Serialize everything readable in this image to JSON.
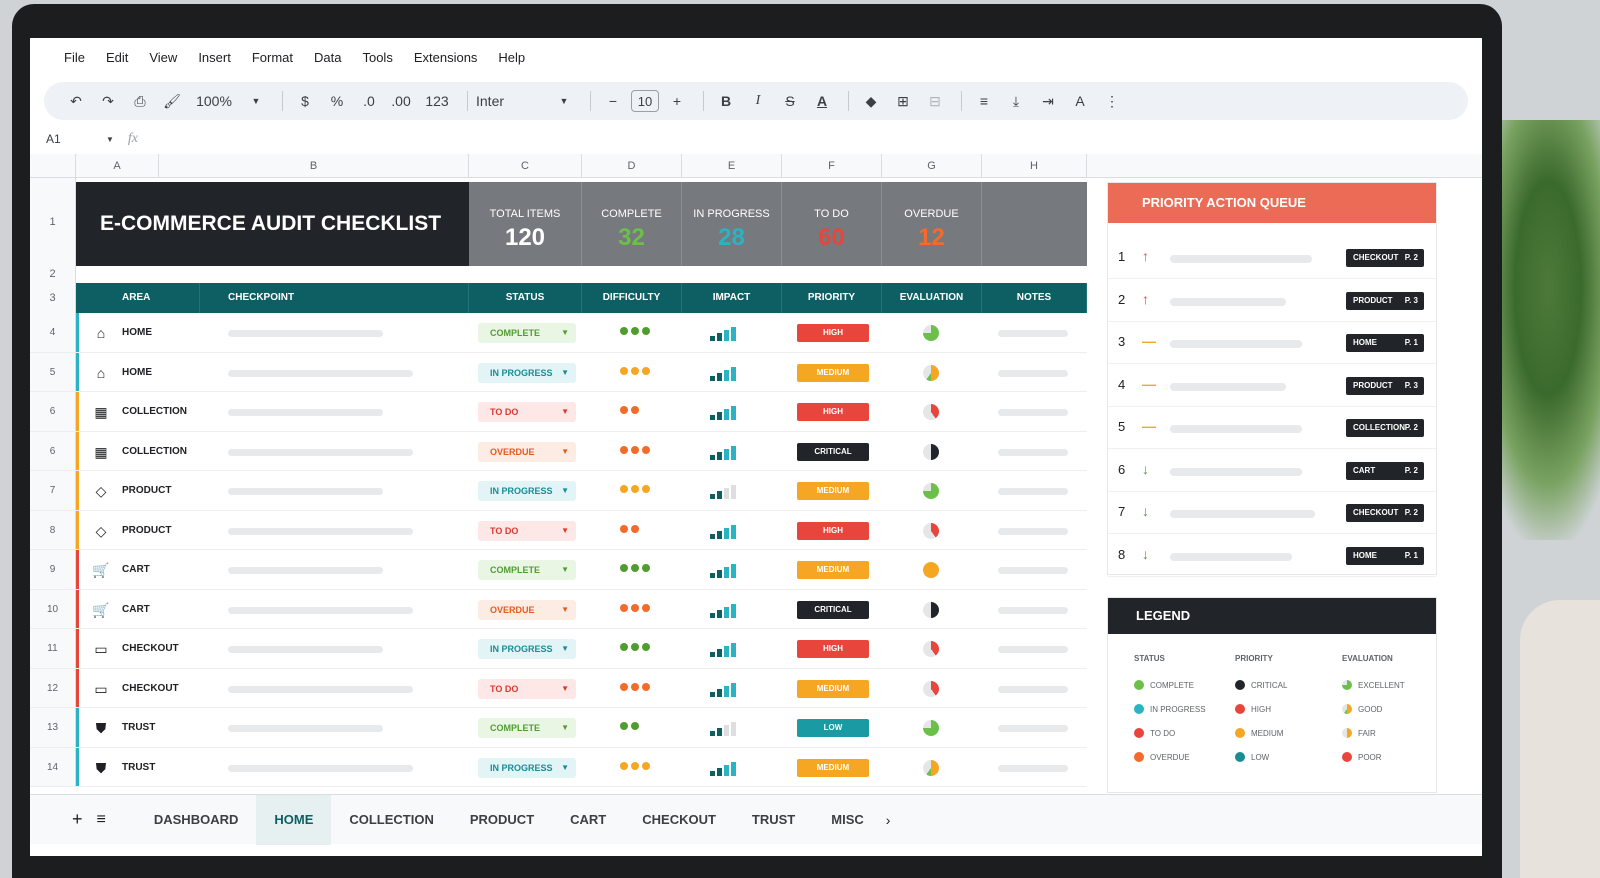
{
  "menu": [
    "File",
    "Edit",
    "View",
    "Insert",
    "Format",
    "Data",
    "Tools",
    "Extensions",
    "Help"
  ],
  "toolbar": {
    "zoom": "100%",
    "currency": "$",
    "percent": "%",
    "dec_down": ".0",
    "dec_up": ".00",
    "number_format": "123",
    "font": "Inter",
    "font_size": "10",
    "bold": "B",
    "italic": "I"
  },
  "formula": {
    "cell_ref": "A1",
    "fx": "fx"
  },
  "columns": [
    "A",
    "B",
    "C",
    "D",
    "E",
    "F",
    "G",
    "H"
  ],
  "title": "E-COMMERCE AUDIT CHECKLIST",
  "stats": [
    {
      "label": "TOTAL ITEMS",
      "value": "120",
      "color": "#ffffff"
    },
    {
      "label": "COMPLETE",
      "value": "32",
      "color": "#6cc04a"
    },
    {
      "label": "IN PROGRESS",
      "value": "28",
      "color": "#2ab3c2"
    },
    {
      "label": "TO DO",
      "value": "60",
      "color": "#e8453c"
    },
    {
      "label": "OVERDUE",
      "value": "12",
      "color": "#f36b2a"
    }
  ],
  "headers": [
    "AREA",
    "CHECKPOINT",
    "STATUS",
    "DIFFICULTY",
    "IMPACT",
    "PRIORITY",
    "EVALUATION",
    "NOTES"
  ],
  "row_numbers_top": [
    "1",
    "2",
    "3"
  ],
  "rows": [
    {
      "n": "4",
      "area": "HOME",
      "icon": "home-icon",
      "bar": "#2ab3c2",
      "status": "COMPLETE",
      "priority": "HIGH",
      "dots": 3,
      "sig": 4,
      "eval": "excellent"
    },
    {
      "n": "5",
      "area": "HOME",
      "icon": "home-icon",
      "bar": "#2ab3c2",
      "status": "IN PROGRESS",
      "priority": "MEDIUM",
      "dots": 3,
      "sig": 4,
      "eval": "good"
    },
    {
      "n": "6",
      "area": "COLLECTION",
      "icon": "grid-icon",
      "bar": "#f5a623",
      "status": "TO DO",
      "priority": "HIGH",
      "dots": 2,
      "sig": 4,
      "eval": "poor"
    },
    {
      "n": "6",
      "area": "COLLECTION",
      "icon": "grid-icon",
      "bar": "#f5a623",
      "status": "OVERDUE",
      "priority": "CRITICAL",
      "dots": 3,
      "sig": 4,
      "eval": "critical"
    },
    {
      "n": "7",
      "area": "PRODUCT",
      "icon": "tag-icon",
      "bar": "#f5a623",
      "status": "IN PROGRESS",
      "priority": "MEDIUM",
      "dots": 3,
      "sig": 2,
      "eval": "excellent"
    },
    {
      "n": "8",
      "area": "PRODUCT",
      "icon": "tag-icon",
      "bar": "#f5a623",
      "status": "TO DO",
      "priority": "HIGH",
      "dots": 2,
      "sig": 4,
      "eval": "poor"
    },
    {
      "n": "9",
      "area": "CART",
      "icon": "cart-icon",
      "bar": "#e8453c",
      "status": "COMPLETE",
      "priority": "MEDIUM",
      "dots": 3,
      "sig": 4,
      "eval": "fair"
    },
    {
      "n": "10",
      "area": "CART",
      "icon": "cart-icon",
      "bar": "#e8453c",
      "status": "OVERDUE",
      "priority": "CRITICAL",
      "dots": 3,
      "sig": 4,
      "eval": "critical"
    },
    {
      "n": "11",
      "area": "CHECKOUT",
      "icon": "card-icon",
      "bar": "#e8453c",
      "status": "IN PROGRESS",
      "priority": "HIGH",
      "dots": 3,
      "sig": 4,
      "eval": "poor"
    },
    {
      "n": "12",
      "area": "CHECKOUT",
      "icon": "card-icon",
      "bar": "#e8453c",
      "status": "TO DO",
      "priority": "MEDIUM",
      "dots": 3,
      "sig": 4,
      "eval": "poor"
    },
    {
      "n": "13",
      "area": "TRUST",
      "icon": "shield-icon",
      "bar": "#2ab3c2",
      "status": "COMPLETE",
      "priority": "LOW",
      "dots": 2,
      "sig": 2,
      "eval": "excellent"
    },
    {
      "n": "14",
      "area": "TRUST",
      "icon": "shield-icon",
      "bar": "#2ab3c2",
      "status": "IN PROGRESS",
      "priority": "MEDIUM",
      "dots": 3,
      "sig": 4,
      "eval": "good"
    }
  ],
  "queue": {
    "title": "PRIORITY ACTION QUEUE",
    "items": [
      {
        "num": "1",
        "dir": "up",
        "area": "CHECKOUT",
        "page": "P. 2"
      },
      {
        "num": "2",
        "dir": "up",
        "area": "PRODUCT",
        "page": "P. 3"
      },
      {
        "num": "3",
        "dir": "flat",
        "area": "HOME",
        "page": "P. 1"
      },
      {
        "num": "4",
        "dir": "flat",
        "area": "PRODUCT",
        "page": "P. 3"
      },
      {
        "num": "5",
        "dir": "flat",
        "area": "COLLECTION",
        "page": "P. 2"
      },
      {
        "num": "6",
        "dir": "down",
        "area": "CART",
        "page": "P. 2"
      },
      {
        "num": "7",
        "dir": "down",
        "area": "CHECKOUT",
        "page": "P. 2"
      },
      {
        "num": "8",
        "dir": "down",
        "area": "HOME",
        "page": "P. 1"
      }
    ]
  },
  "legend": {
    "title": "LEGEND",
    "status": {
      "title": "STATUS",
      "items": [
        {
          "label": "COMPLETE",
          "color": "#6cc04a"
        },
        {
          "label": "IN PROGRESS",
          "color": "#2ab3c2"
        },
        {
          "label": "TO DO",
          "color": "#e8453c"
        },
        {
          "label": "OVERDUE",
          "color": "#f36b2a"
        }
      ]
    },
    "priority": {
      "title": "PRIORITY",
      "items": [
        {
          "label": "CRITICAL",
          "color": "#212428"
        },
        {
          "label": "HIGH",
          "color": "#e8453c"
        },
        {
          "label": "MEDIUM",
          "color": "#f5a623"
        },
        {
          "label": "LOW",
          "color": "#1a8c95"
        }
      ]
    },
    "evaluation": {
      "title": "EVALUATION",
      "items": [
        {
          "label": "EXCELLENT",
          "color": "#6cc04a"
        },
        {
          "label": "GOOD",
          "color": "#f5a623"
        },
        {
          "label": "FAIR",
          "color": "#f5a623"
        },
        {
          "label": "POOR",
          "color": "#e8453c"
        }
      ]
    }
  },
  "tabs": [
    "DASHBOARD",
    "HOME",
    "COLLECTION",
    "PRODUCT",
    "CART",
    "CHECKOUT",
    "TRUST",
    "MISC"
  ],
  "active_tab": "HOME",
  "colors": {
    "teal": "#0d5f63",
    "coral": "#ec6b56",
    "dark": "#212428"
  }
}
